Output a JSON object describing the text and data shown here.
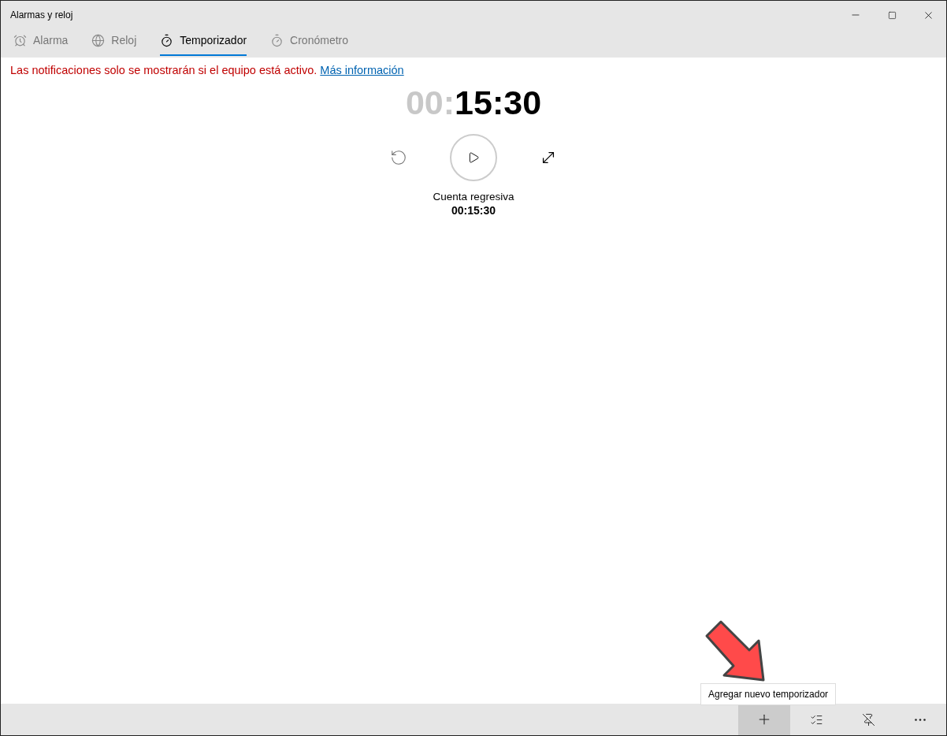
{
  "window": {
    "title": "Alarmas y reloj"
  },
  "tabs": [
    {
      "label": "Alarma",
      "kind": "alarm",
      "selected": false
    },
    {
      "label": "Reloj",
      "kind": "clock",
      "selected": false
    },
    {
      "label": "Temporizador",
      "kind": "timer",
      "selected": true
    },
    {
      "label": "Cronómetro",
      "kind": "stopwatch",
      "selected": false
    }
  ],
  "notice": {
    "text": "Las notificaciones solo se mostrarán si el equipo está activo.",
    "link": "Más información"
  },
  "timer": {
    "hours": "00:",
    "rest": "15:30",
    "name": "Cuenta regresiva",
    "time": "00:15:30"
  },
  "tooltip": "Agregar nuevo temporizador",
  "toolbar": [
    {
      "kind": "add",
      "hovered": true
    },
    {
      "kind": "list",
      "hovered": false
    },
    {
      "kind": "pin",
      "hovered": false
    },
    {
      "kind": "more",
      "hovered": false
    }
  ]
}
